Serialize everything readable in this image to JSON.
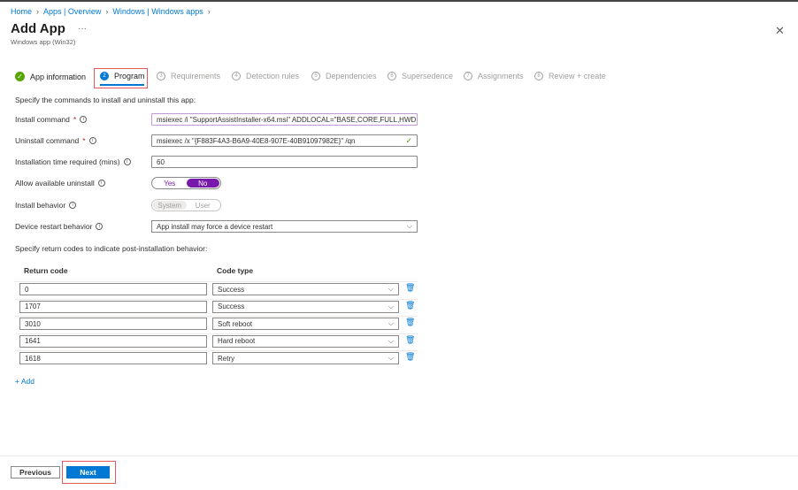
{
  "breadcrumb": [
    "Home",
    "Apps | Overview",
    "Windows | Windows apps"
  ],
  "title": "Add App",
  "subtitle": "Windows app (Win32)",
  "tabs": [
    {
      "num": "",
      "label": "App information",
      "state": "complete"
    },
    {
      "num": "2",
      "label": "Program",
      "state": "active"
    },
    {
      "num": "3",
      "label": "Requirements"
    },
    {
      "num": "4",
      "label": "Detection rules"
    },
    {
      "num": "5",
      "label": "Dependencies"
    },
    {
      "num": "6",
      "label": "Supersedence"
    },
    {
      "num": "7",
      "label": "Assignments"
    },
    {
      "num": "8",
      "label": "Review + create"
    }
  ],
  "intro": "Specify the commands to install and uninstall this app:",
  "fields": {
    "install_label": "Install command",
    "install_value": "msiexec /i \"SupportAssistInstaller-x64.msi\" ADDLOCAL=\"BASE,CORE,FULL,HWD...",
    "uninstall_label": "Uninstall command",
    "uninstall_value": "msiexec /x \"{F883F4A3-B6A9-40E8-907E-40B91097982E}\" /qn",
    "time_label": "Installation time required (mins)",
    "time_value": "60",
    "allow_label": "Allow available uninstall",
    "allow_yes": "Yes",
    "allow_no": "No",
    "allow_selected": "No",
    "behavior_label": "Install behavior",
    "behavior_system": "System",
    "behavior_user": "User",
    "behavior_selected": "System",
    "restart_label": "Device restart behavior",
    "restart_value": "App install may force a device restart",
    "required_mark": "*"
  },
  "return_intro": "Specify return codes to indicate post-installation behavior:",
  "table": {
    "col1": "Return code",
    "col2": "Code type",
    "rows": [
      {
        "code": "0",
        "type": "Success"
      },
      {
        "code": "1707",
        "type": "Success"
      },
      {
        "code": "3010",
        "type": "Soft reboot"
      },
      {
        "code": "1641",
        "type": "Hard reboot"
      },
      {
        "code": "1618",
        "type": "Retry"
      }
    ]
  },
  "add_label": "+ Add",
  "footer": {
    "previous": "Previous",
    "next": "Next"
  },
  "colors": {
    "accent": "#0078d4",
    "toggle_on": "#7719aa",
    "success": "#57a300",
    "highlight": "#e8585a"
  }
}
